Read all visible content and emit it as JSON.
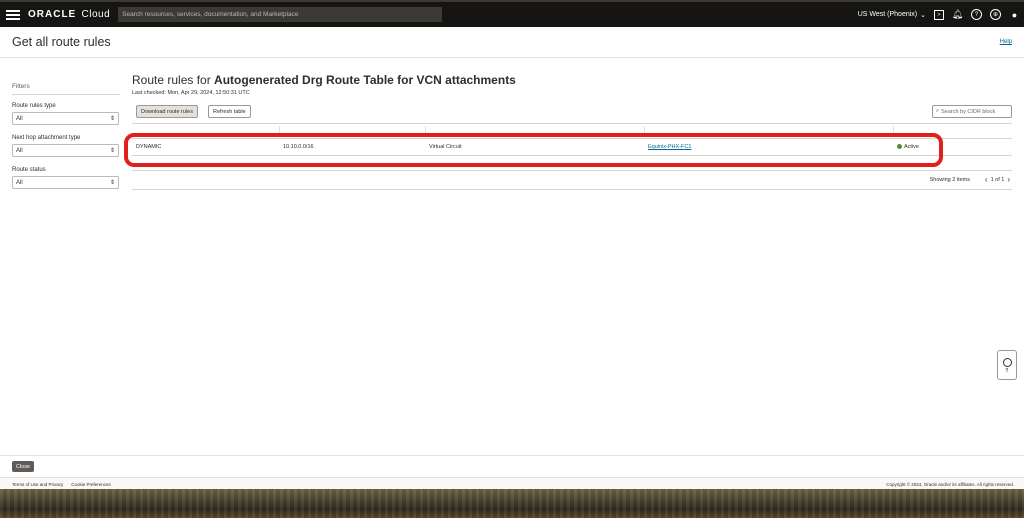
{
  "header": {
    "brand_bold": "ORACLE",
    "brand_light": "Cloud",
    "search_placeholder": "Search resources, services, documentation, and Marketplace",
    "region": "US West (Phoenix)"
  },
  "panel": {
    "title": "Get all route rules",
    "help": "Help"
  },
  "filters": {
    "title": "Filters",
    "groups": [
      {
        "label": "Route rules type",
        "value": "All"
      },
      {
        "label": "Next hop attachment type",
        "value": "All"
      },
      {
        "label": "Route status",
        "value": "All"
      }
    ]
  },
  "main": {
    "title_prefix": "Route rules for",
    "title_bold": "Autogenerated Drg Route Table for VCN attachments",
    "last_checked": "Last checked: Mon, Apr 29, 2024, 12:50:31 UTC",
    "download_label": "Download route rules",
    "refresh_label": "Refresh table",
    "cidr_placeholder": "Search by CIDR block"
  },
  "table": {
    "rows": [
      {
        "type": "DYNAMIC",
        "cidr": "10.10.0.0/16",
        "next_hop_type": "Virtual Circuit",
        "next_hop": "Equinix-PHX-FC1",
        "status": "Active"
      }
    ],
    "showing": "Showing 2 items",
    "page": "1 of 1"
  },
  "bottom": {
    "close_label": "Close"
  },
  "footer": {
    "terms": "Terms of Use and Privacy",
    "cookies": "Cookie Preferences",
    "copyright": "Copyright © 2024, Oracle and/or its affiliates. All rights reserved."
  },
  "colors": {
    "highlight": "#e0201b",
    "active_status": "#5c8a3a",
    "link": "#00688c"
  }
}
